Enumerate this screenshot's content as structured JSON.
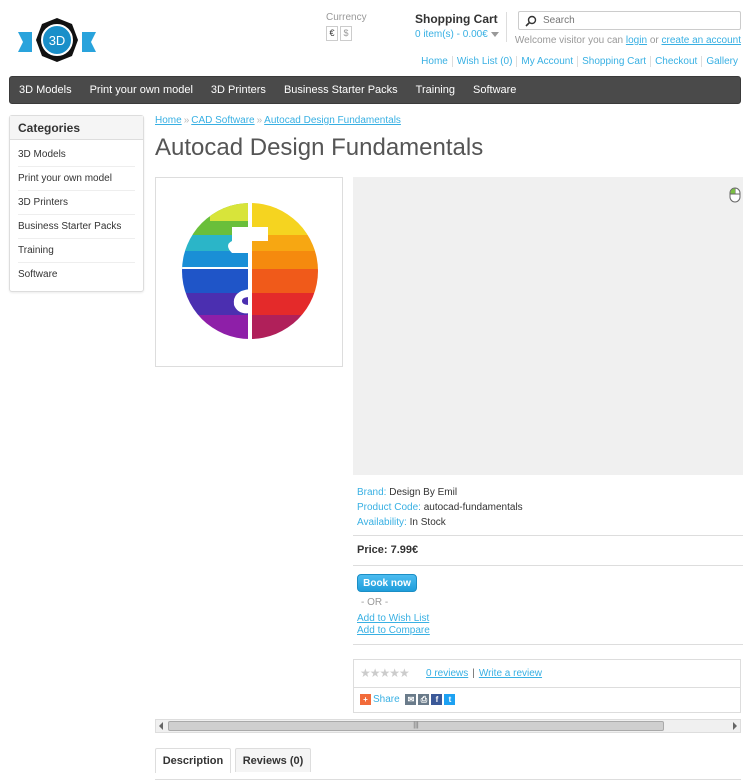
{
  "header": {
    "logo_text": "3D",
    "currency_label": "Currency",
    "currencies": [
      "€",
      "$"
    ],
    "cart_title": "Shopping Cart",
    "cart_items": "0 item(s) - 0.00€",
    "search_placeholder": "Search",
    "welcome_prefix": "Welcome visitor you can",
    "login_label": "login",
    "or_label": "or",
    "create_account_label": "create an account"
  },
  "top_links": [
    "Home",
    "Wish List (0)",
    "My Account",
    "Shopping Cart",
    "Checkout",
    "Gallery"
  ],
  "menu": [
    "3D Models",
    "Print your own model",
    "3D Printers",
    "Business Starter Packs",
    "Training",
    "Software"
  ],
  "categories": {
    "title": "Categories",
    "items": [
      "3D Models",
      "Print your own model",
      "3D Printers",
      "Business Starter Packs",
      "Training",
      "Software"
    ]
  },
  "breadcrumb": [
    "Home",
    "CAD Software",
    "Autocad Design Fundamentals"
  ],
  "product": {
    "title": "Autocad Design Fundamentals",
    "brand_label": "Brand:",
    "brand": "Design By Emil",
    "code_label": "Product Code:",
    "code": "autocad-fundamentals",
    "availability_label": "Availability:",
    "availability": "In Stock",
    "price": "Price: 7.99€",
    "book_now": "Book now",
    "or": "- OR -",
    "add_wishlist": "Add to Wish List",
    "add_compare": "Add to Compare",
    "reviews_link": "0 reviews",
    "write_review": "Write a review",
    "share_label": "Share",
    "rating": 0
  },
  "scrollbar_grip": "|||",
  "tabs": [
    "Description",
    "Reviews (0)"
  ],
  "colors": {
    "accent": "#38b0e3",
    "menu_bg": "#4a4a4a",
    "logo_blue": "#1a8fc9"
  }
}
